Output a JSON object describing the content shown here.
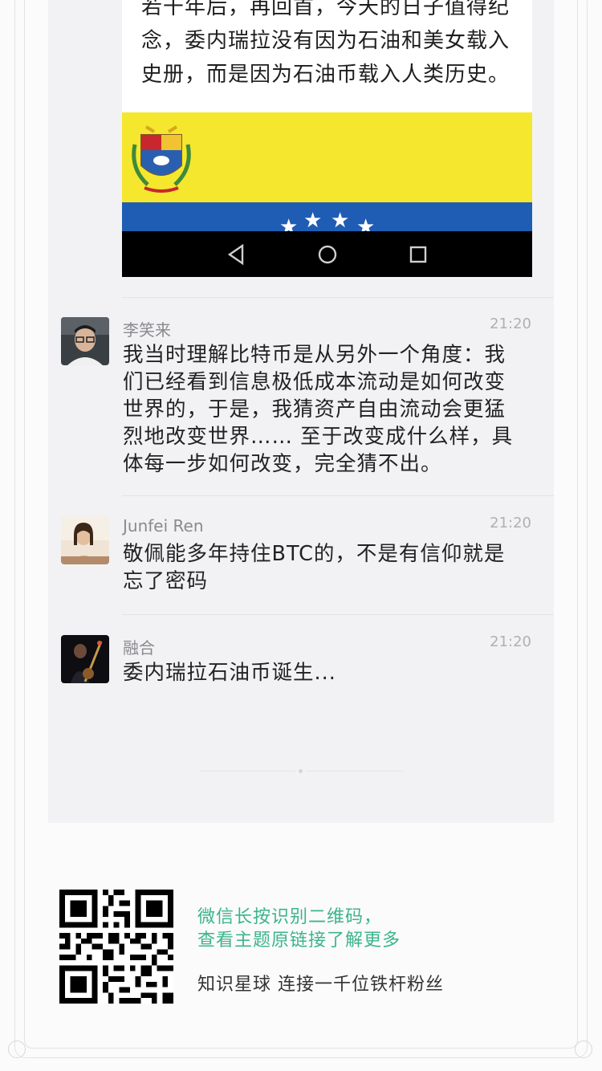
{
  "article_preview": {
    "text": "若干年后，再回首，今天的日子值得纪念，委内瑞拉没有因为石油和美女载入史册，而是因为石油币载入人类历史。"
  },
  "comments": [
    {
      "name": "李笑来",
      "time": "21:20",
      "text": "我当时理解比特币是从另外一个角度：我们已经看到信息极低成本流动是如何改变世界的，于是，我猜资产自由流动会更猛烈地改变世界…… 至于改变成什么样，具体每一步如何改变，完全猜不出。"
    },
    {
      "name": "Junfei Ren",
      "time": "21:20",
      "text": "敬佩能多年持住BTC的，不是有信仰就是忘了密码"
    },
    {
      "name": "融合",
      "time": "21:20",
      "text": "委内瑞拉石油币诞生..."
    }
  ],
  "footer": {
    "qr_hint_line1": "微信长按识别二维码，",
    "qr_hint_line2": "查看主题原链接了解更多",
    "slogan": "知识星球 连接一千位铁杆粉丝"
  },
  "colors": {
    "accent_green": "#3cb48c",
    "flag_yellow": "#f5e72d",
    "flag_blue": "#1f5db4"
  }
}
